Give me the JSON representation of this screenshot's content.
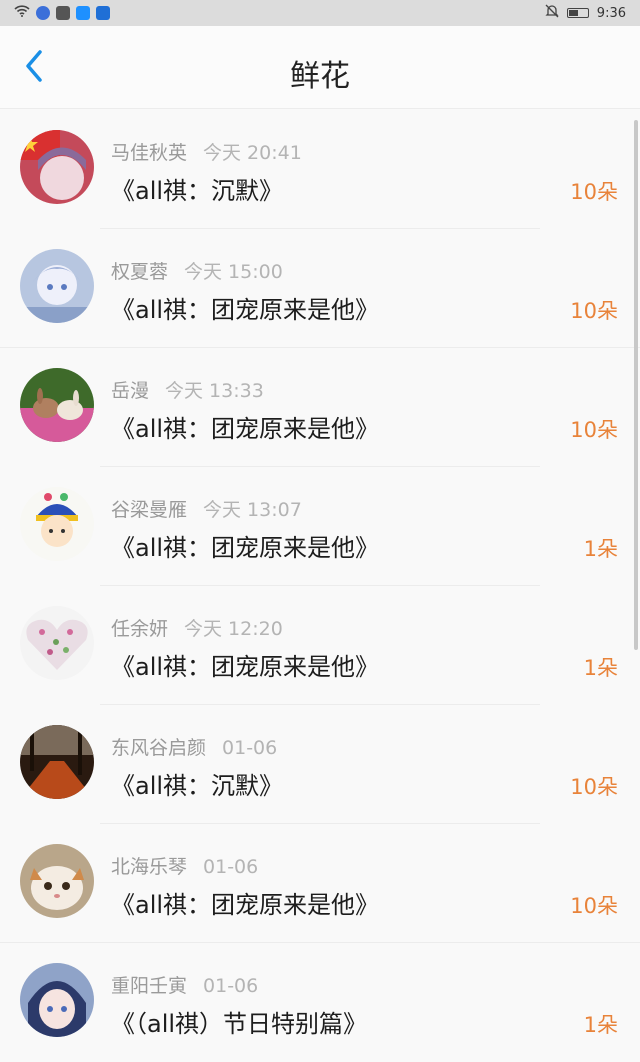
{
  "status_bar": {
    "time": "9:36"
  },
  "header": {
    "title": "鲜花"
  },
  "items": [
    {
      "user": "马佳秋英",
      "time": "今天 20:41",
      "book": "《all祺：沉默》",
      "count": "10朵",
      "avatar_bg": "#c44a5a"
    },
    {
      "user": "权夏蓉",
      "time": "今天 15:00",
      "book": "《all祺：团宠原来是他》",
      "count": "10朵",
      "avatar_bg": "#b7c6e0"
    },
    {
      "user": "岳漫",
      "time": "今天 13:33",
      "book": "《all祺：团宠原来是他》",
      "count": "10朵",
      "avatar_bg": "#6a8a3c"
    },
    {
      "user": "谷梁曼雁",
      "time": "今天 13:07",
      "book": "《all祺：团宠原来是他》",
      "count": "1朵",
      "avatar_bg": "#f5f5f0"
    },
    {
      "user": "任余妍",
      "time": "今天 12:20",
      "book": "《all祺：团宠原来是他》",
      "count": "1朵",
      "avatar_bg": "#f2f2f2"
    },
    {
      "user": "东风谷启颜",
      "time": "01-06",
      "book": "《all祺：沉默》",
      "count": "10朵",
      "avatar_bg": "#5a3a22"
    },
    {
      "user": "北海乐琴",
      "time": "01-06",
      "book": "《all祺：团宠原来是他》",
      "count": "10朵",
      "avatar_bg": "#c9b59a"
    },
    {
      "user": "重阳壬寅",
      "time": "01-06",
      "book": "《（all祺）节日特别篇》",
      "count": "1朵",
      "avatar_bg": "#8fa3c8"
    }
  ]
}
